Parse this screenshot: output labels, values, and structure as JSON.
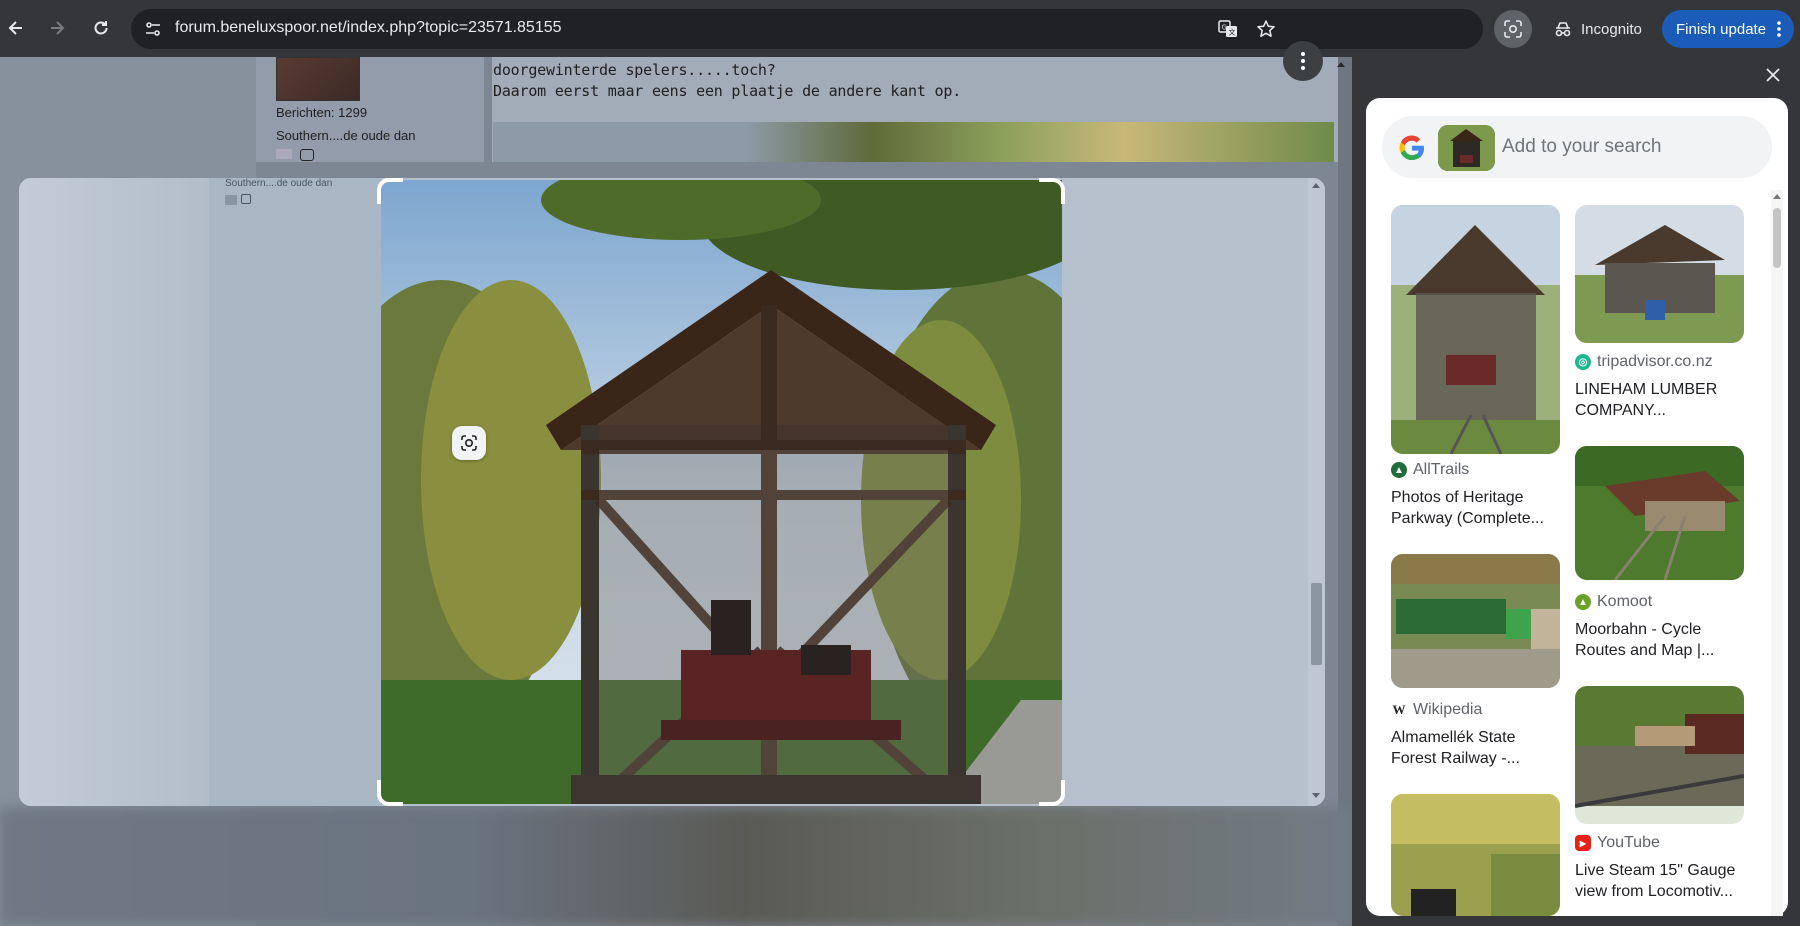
{
  "browser": {
    "url": "forum.beneluxspoor.net/index.php?topic=23571.85155",
    "incognito_label": "Incognito",
    "finish_update_label": "Finish update",
    "accent_color": "#1a5cb8"
  },
  "page": {
    "berichten": "Berichten: 1299",
    "member_text": "Southern....de oude dan",
    "post_line_1": "doorgewinterde spelers.....toch?",
    "post_line_2": "Daarom eerst maar eens een plaatje de andere kant op.",
    "overlay_member_text": "Southern....de oude dan"
  },
  "lens": {
    "search_placeholder": "Add to your search",
    "results": [
      {
        "source": "AllTrails",
        "title": "Photos of Heritage Parkway (Complete...",
        "favicon_color": "#1f6d3a"
      },
      {
        "source": "tripadvisor.co.nz",
        "title": "LINEHAM LUMBER COMPANY...",
        "favicon_color": "#1cb88e"
      },
      {
        "source": "Komoot",
        "title": "Moorbahn - Cycle Routes and Map |...",
        "favicon_color": "#6aa127"
      },
      {
        "source": "Wikipedia",
        "title": "Almamellék State Forest Railway -...",
        "favicon_color": "#ffffff"
      },
      {
        "source": "YouTube",
        "title": "Live Steam 15\" Gauge view from Locomotiv...",
        "favicon_color": "#e62117"
      }
    ]
  },
  "icons": [
    "back-icon",
    "forward-icon",
    "reload-icon",
    "site-info-icon",
    "translate-icon",
    "bookmark-star-icon",
    "lens-icon",
    "incognito-icon",
    "more-vert-icon",
    "close-icon",
    "google-logo"
  ]
}
